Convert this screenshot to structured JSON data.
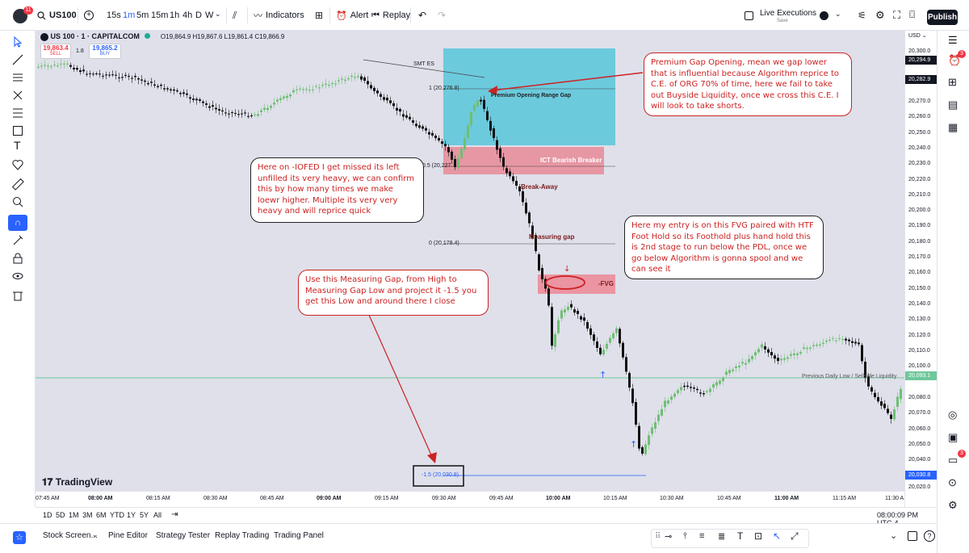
{
  "topbar": {
    "avatar_badge": "11",
    "symbol": "US100",
    "timeframes": [
      "15s",
      "1m",
      "5m",
      "15m",
      "1h",
      "4h",
      "D",
      "W"
    ],
    "active_timeframe": "1m",
    "indicators_label": "Indicators",
    "alert_label": "Alert",
    "replay_label": "Replay",
    "live_executions_label": "Live Executions",
    "save_label": "Save",
    "publish_label": "Publish"
  },
  "legend": {
    "title": "US 100 · 1 · CAPITALCOM",
    "ohlc": "O19,864.9 H19,867.6 L19,861.4 C19,866.9",
    "sell_price": "19,863.4",
    "sell_label": "SELL",
    "spread": "1.8",
    "buy_price": "19,865.2",
    "buy_label": "BUY"
  },
  "price_axis": {
    "currency": "USD",
    "labels": [
      "20,300.0",
      "20,280.0",
      "20,270.0",
      "20,260.0",
      "20,250.0",
      "20,240.0",
      "20,230.0",
      "20,220.0",
      "20,210.0",
      "20,200.0",
      "20,190.0",
      "20,180.0",
      "20,170.0",
      "20,160.0",
      "20,150.0",
      "20,140.0",
      "20,130.0",
      "20,120.0",
      "20,110.0",
      "20,100.0",
      "20,080.0",
      "20,070.0",
      "20,060.0",
      "20,050.0",
      "20,040.0",
      "20,020.0"
    ],
    "tags": [
      {
        "text": "20,294.9",
        "color": "#131722"
      },
      {
        "text": "20,282.9",
        "color": "#131722"
      },
      {
        "text": "20,093.1",
        "color": "#6fc79a"
      },
      {
        "text": "20,030.8",
        "color": "#2962ff"
      }
    ]
  },
  "time_axis": {
    "labels": [
      {
        "text": "07:45 AM",
        "bold": false
      },
      {
        "text": "08:00 AM",
        "bold": true
      },
      {
        "text": "08:15 AM",
        "bold": false
      },
      {
        "text": "08:30 AM",
        "bold": false
      },
      {
        "text": "08:45 AM",
        "bold": false
      },
      {
        "text": "09:00 AM",
        "bold": true
      },
      {
        "text": "09:15 AM",
        "bold": false
      },
      {
        "text": "09:30 AM",
        "bold": false
      },
      {
        "text": "09:45 AM",
        "bold": false
      },
      {
        "text": "10:00 AM",
        "bold": true
      },
      {
        "text": "10:15 AM",
        "bold": false
      },
      {
        "text": "10:30 AM",
        "bold": false
      },
      {
        "text": "10:45 AM",
        "bold": false
      },
      {
        "text": "11:00 AM",
        "bold": true
      },
      {
        "text": "11:15 AM",
        "bold": false
      },
      {
        "text": "11:30 A",
        "bold": false
      }
    ]
  },
  "ranges": [
    "1D",
    "5D",
    "1M",
    "3M",
    "6M",
    "YTD",
    "1Y",
    "5Y",
    "All"
  ],
  "clock": "08:00:09 PM UTC-4",
  "bottom_panels": [
    "Stock Screen...",
    "Pine Editor",
    "Strategy Tester",
    "Replay Trading",
    "Trading Panel"
  ],
  "right_badge": "3",
  "chart_labels": {
    "smt": "SMT ES",
    "fib_1": "1 (20,276.8)",
    "premium_gap": "Premium Opening Range Gap",
    "fib_05": "0.5 (20,227.",
    "bearish_breaker": "ICT Bearish Breaker",
    "break_away": "Break-Away",
    "measuring_gap": "Measuring gap",
    "fib_0": "0 (20,178.4)",
    "fvg": "-FVG",
    "fib_neg15": "-1.5 (20,030.8)",
    "pdl": "Previous Daily Low / Sellside Liquidity",
    "watermark": "TradingView"
  },
  "notes": {
    "premium": "Premium Gap Opening, mean we gap lower that is influential because Algorithm reprice to C.E. of ORG 70% of time, here we fail to take out Buyside Liquidity, once we cross this C.E. I will look to take shorts.",
    "iofed": "Here on -IOFED I get missed its left unfilled its very heavy, we can confirm this by how many times we make loewr higher. Multiple its very very heavy and will reprice quick",
    "entry": "Here my entry is on this FVG paired with HTF Foot Hold so its Foothold plus hand hold this is 2nd stage to run below the PDL, once we go below Algorithm is gonna spool and we can see it",
    "measuring": "Use this Measuring Gap, from High to Measuring Gap Low and project it -1.5 you get this Low and around there I close"
  },
  "colors": {
    "chart_bg": "#dfe0ea",
    "bull": "#6fbf73",
    "bear": "#111111",
    "premium_zone": "#5fc8dc",
    "breaker_zone": "#e88a96",
    "fvg_zone": "#ec8c9a",
    "pdl_line": "#6fc79a",
    "annotation_red": "#cc2222"
  }
}
